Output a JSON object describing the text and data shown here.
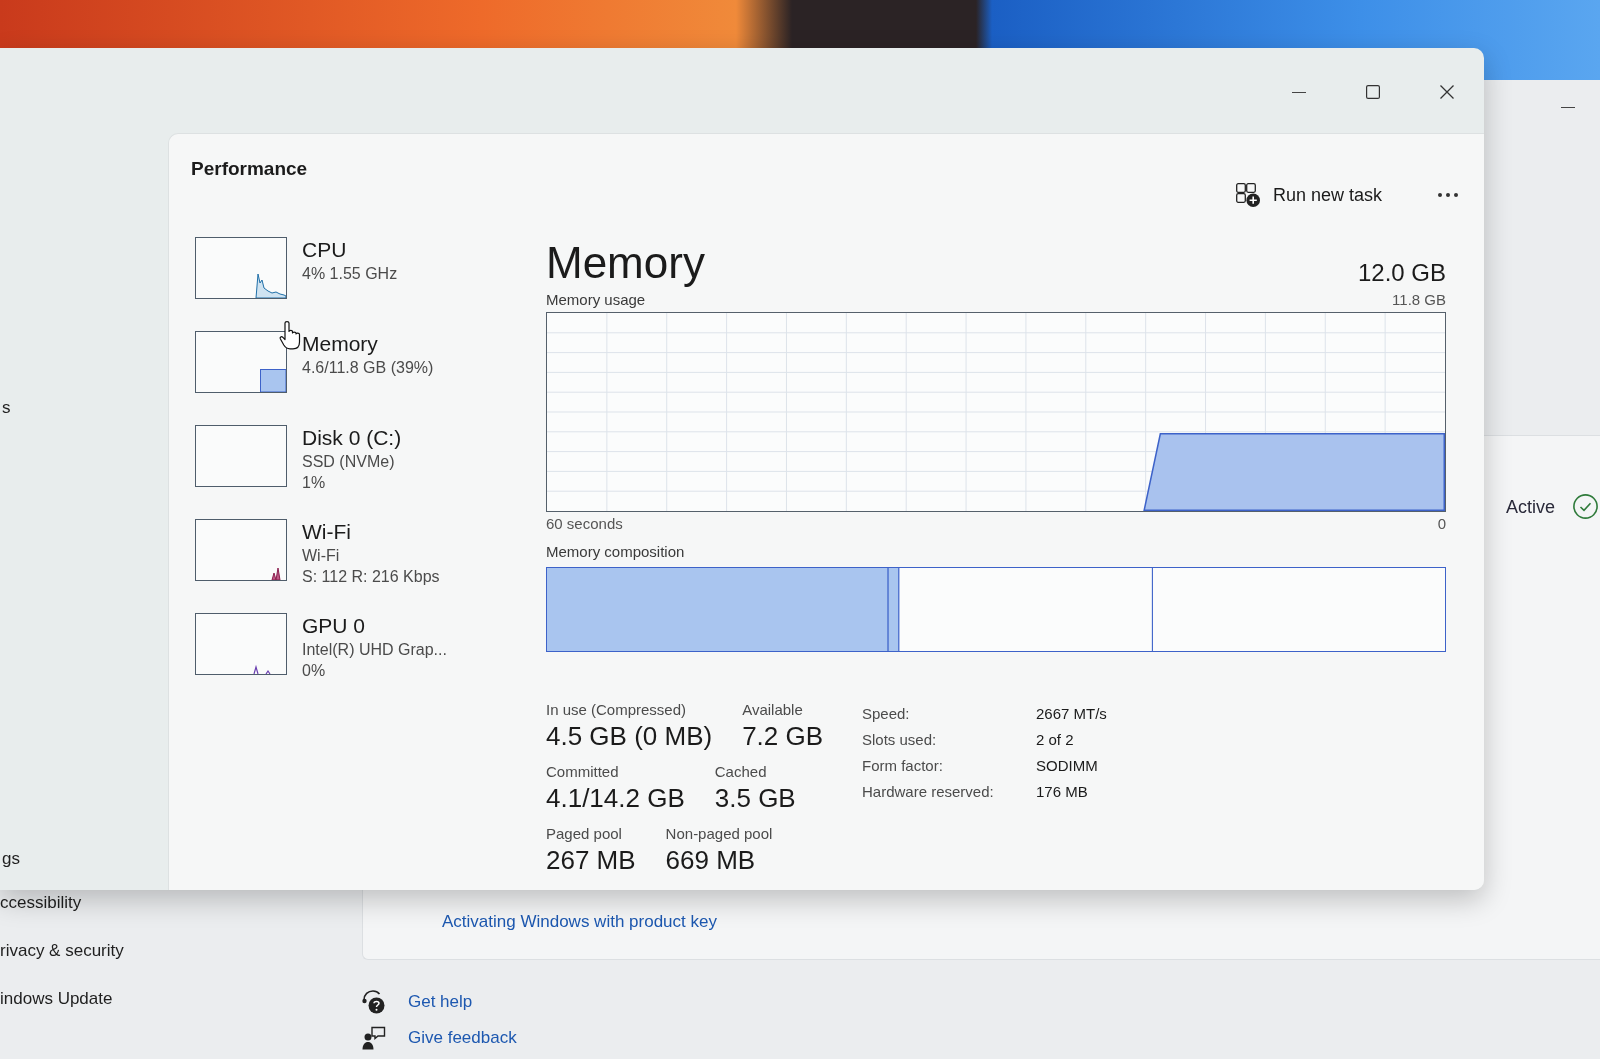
{
  "settings_window": {
    "nav_items": [
      {
        "label": "ccessibility"
      },
      {
        "label": "rivacy & security"
      },
      {
        "label": "indows Update"
      }
    ],
    "activation": {
      "status": "Active",
      "link": "Activating Windows with product key"
    },
    "help_links": [
      {
        "kind": "help",
        "label": "Get help"
      },
      {
        "kind": "feedback",
        "label": "Give feedback"
      }
    ]
  },
  "task_manager": {
    "nav_items": [
      {
        "label": "s"
      },
      {
        "label": "gs"
      }
    ],
    "page_title": "Performance",
    "run_new_task": "Run new task",
    "resources": [
      {
        "kind": "cpu",
        "title": "CPU",
        "details": [
          "4% 1.55 GHz"
        ]
      },
      {
        "kind": "memory",
        "title": "Memory",
        "details": [
          "4.6/11.8 GB (39%)"
        ]
      },
      {
        "kind": "disk",
        "title": "Disk 0 (C:)",
        "details": [
          "SSD (NVMe)",
          "1%"
        ]
      },
      {
        "kind": "network",
        "title": "Wi-Fi",
        "details": [
          "Wi-Fi",
          "S: 112 R: 216 Kbps"
        ]
      },
      {
        "kind": "gpu",
        "title": "GPU 0",
        "details": [
          "Intel(R) UHD Grap...",
          "0%"
        ]
      }
    ],
    "detail": {
      "title": "Memory",
      "total": "12.0 GB",
      "usage_graph": {
        "title": "Memory usage",
        "top_label": "11.8 GB",
        "time_label": "60 seconds",
        "bottom_label": "0"
      },
      "composition_label": "Memory composition",
      "stats": [
        [
          {
            "label": "In use (Compressed)",
            "value": "4.5 GB (0 MB)"
          },
          {
            "label": "Available",
            "value": "7.2 GB"
          }
        ],
        [
          {
            "label": "Committed",
            "value": "4.1/14.2 GB"
          },
          {
            "label": "Cached",
            "value": "3.5 GB"
          }
        ],
        [
          {
            "label": "Paged pool",
            "value": "267 MB"
          },
          {
            "label": "Non-paged pool",
            "value": "669 MB"
          }
        ]
      ],
      "properties": [
        {
          "label": "Speed:",
          "value": "2667 MT/s"
        },
        {
          "label": "Slots used:",
          "value": "2 of 2"
        },
        {
          "label": "Form factor:",
          "value": "SODIMM"
        },
        {
          "label": "Hardware reserved:",
          "value": "176 MB"
        }
      ]
    }
  }
}
